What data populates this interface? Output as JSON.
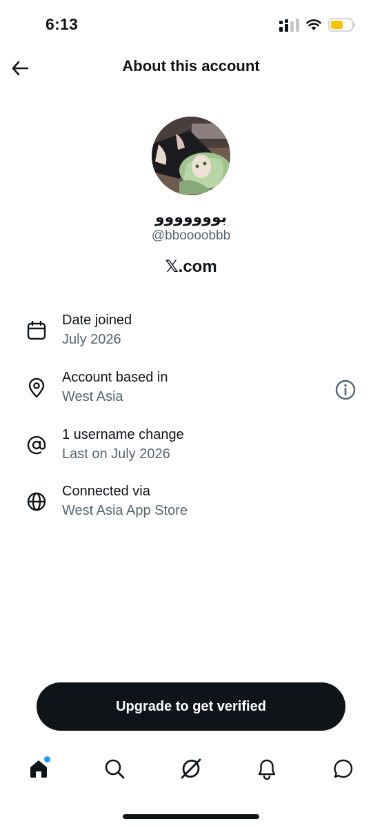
{
  "status_bar": {
    "time": "6:13"
  },
  "header": {
    "title": "About this account",
    "back_icon": "arrow-left-icon"
  },
  "profile": {
    "display_name": "بووووووو",
    "handle": "@bboooobbb",
    "platform": "𝕏.com"
  },
  "info": [
    {
      "icon": "calendar-icon",
      "label": "Date joined",
      "value": "July 2026"
    },
    {
      "icon": "location-pin-icon",
      "label": "Account based in",
      "value": "West Asia",
      "action_icon": "info-icon"
    },
    {
      "icon": "at-sign-icon",
      "label": "1 username change",
      "value": "Last on July 2026"
    },
    {
      "icon": "globe-icon",
      "label": "Connected via",
      "value": "West Asia App Store"
    }
  ],
  "upgrade": {
    "label": "Upgrade to get verified"
  },
  "nav": {
    "items": [
      "home-icon",
      "search-icon",
      "grok-icon",
      "bell-icon",
      "messages-icon"
    ],
    "notification_dot_color": "#1d9bf0"
  },
  "colors": {
    "text": "#0f1419",
    "secondary": "#536471",
    "battery": "#f5c400"
  }
}
